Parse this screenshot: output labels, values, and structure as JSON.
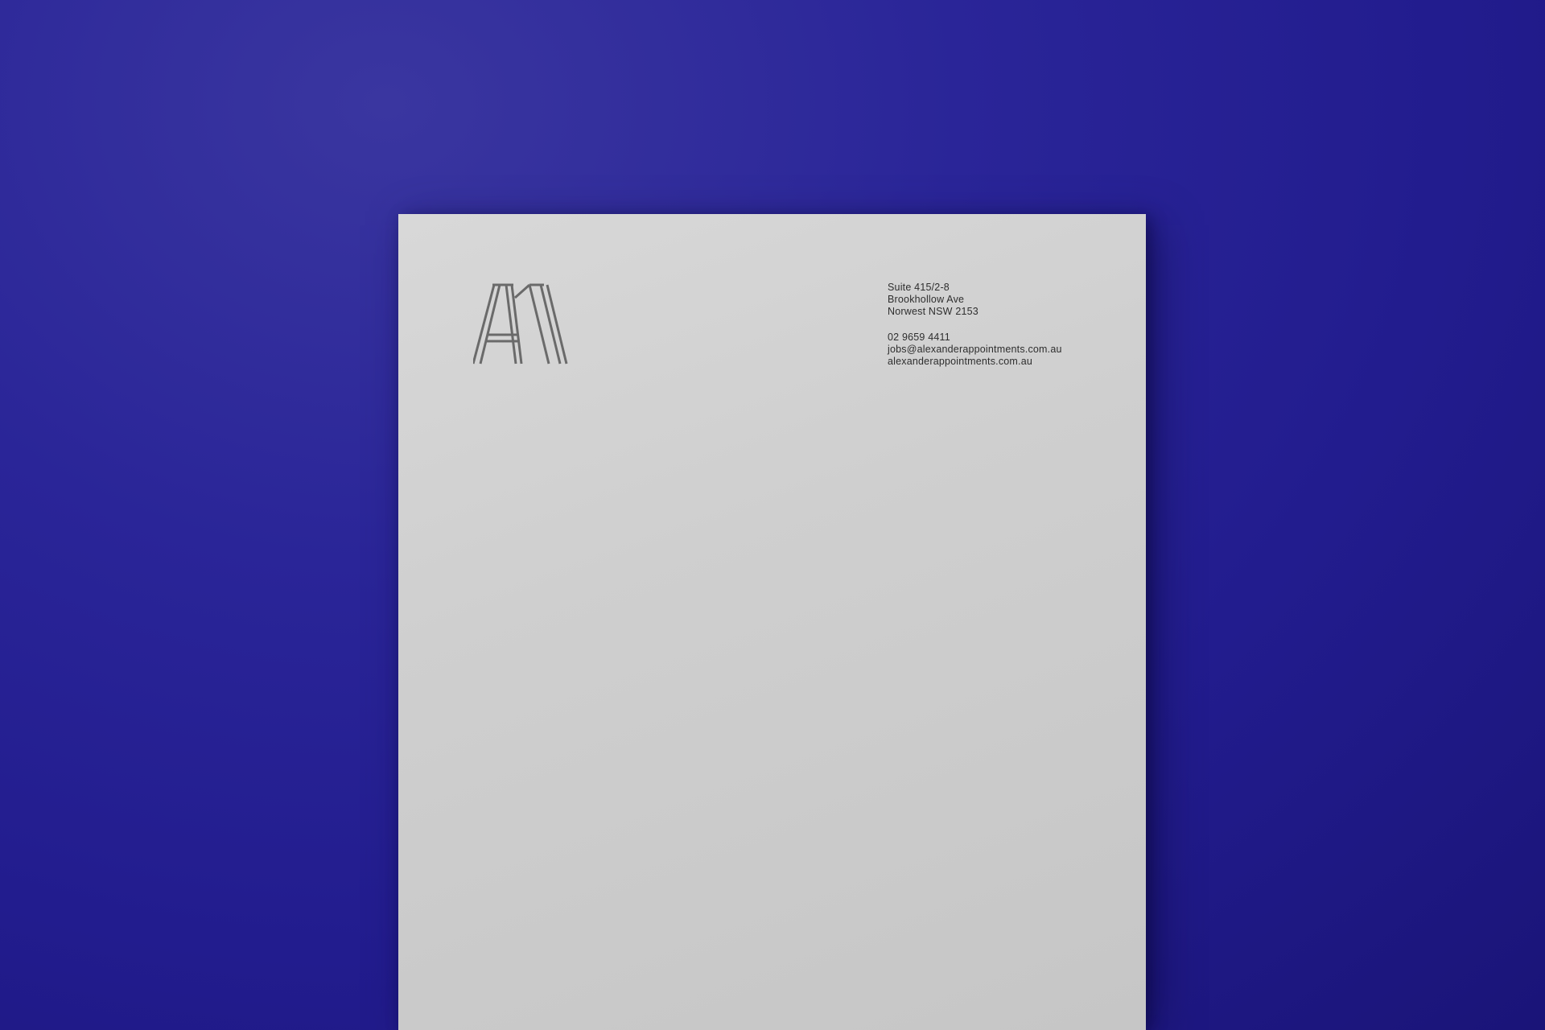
{
  "scene": {
    "background_color": "#2a2598",
    "paper_color": "#d0d0d0",
    "logo_color": "#6a6a6a",
    "text_color": "#2e2e2e"
  },
  "letterhead": {
    "logo": {
      "monogram": "AM",
      "icon": "am-monogram-logo"
    },
    "address": {
      "line1": "Suite 415/2-8",
      "line2": "Brookhollow Ave",
      "line3": "Norwest NSW 2153"
    },
    "contact": {
      "phone": "02 9659 4411",
      "email": "jobs@alexanderappointments.com.au",
      "website": "alexanderappointments.com.au"
    }
  }
}
